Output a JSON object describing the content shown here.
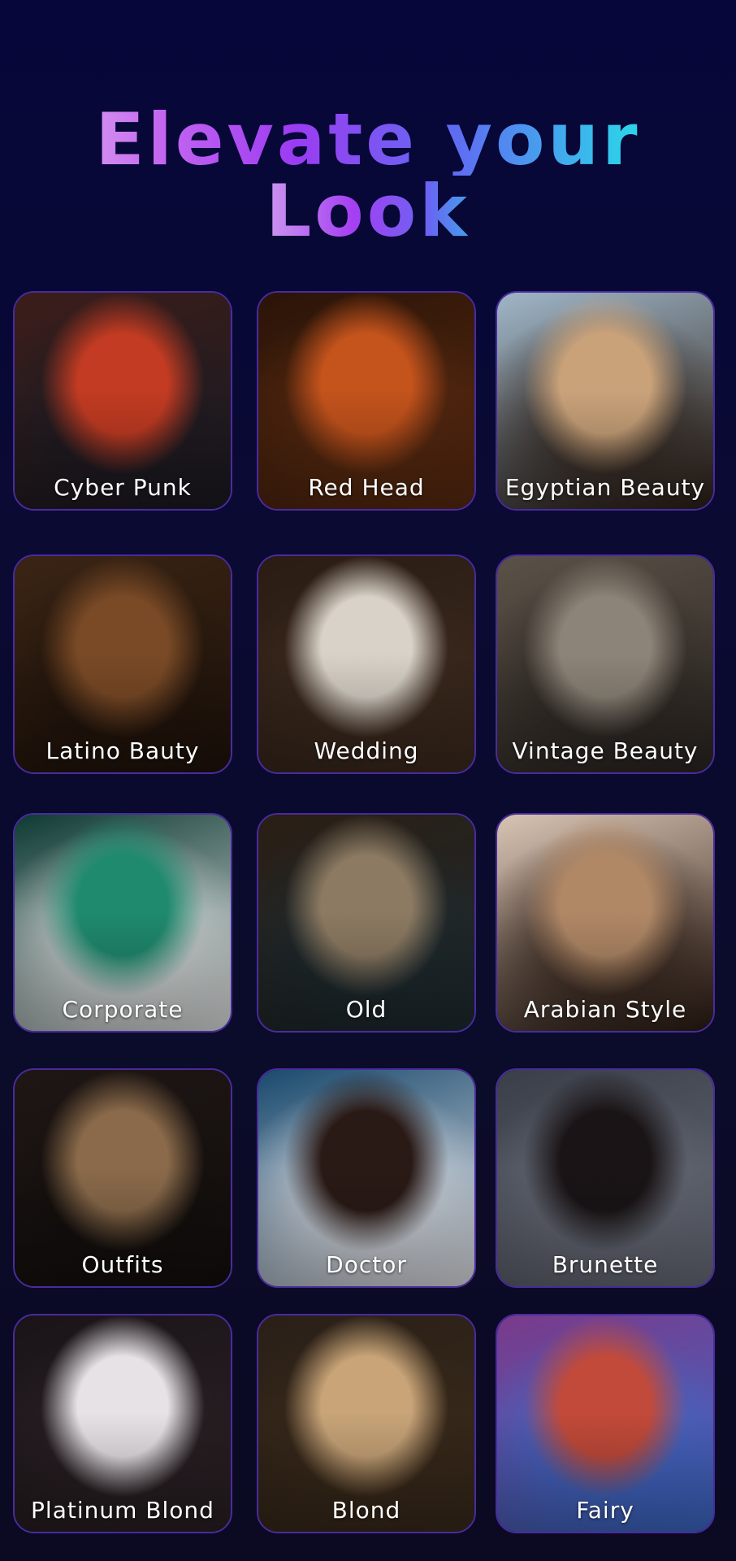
{
  "header": {
    "title_line1": "Elevate your",
    "title_line2": "Look"
  },
  "colors": {
    "background": "#07073a",
    "card_border": "#4a2b9e",
    "label_text": "#ffffff",
    "gradient_start": "#e7c8ef",
    "gradient_mid": "#9b3cf2",
    "gradient_end": "#2fd0ea"
  },
  "styles": [
    {
      "label": "Cyber Punk",
      "icon": "cyberpunk-portrait",
      "tone_a": "#3b1d1a",
      "tone_b": "#c23b22",
      "tone_c": "#1a1a22"
    },
    {
      "label": "Red Head",
      "icon": "redhead-portrait",
      "tone_a": "#2a1408",
      "tone_b": "#c4531c",
      "tone_c": "#5a2a10"
    },
    {
      "label": "Egyptian Beauty",
      "icon": "egyptian-portrait",
      "tone_a": "#9fb6c8",
      "tone_b": "#c9a27a",
      "tone_c": "#2b1d14"
    },
    {
      "label": "Latino Bauty",
      "icon": "latino-portrait",
      "tone_a": "#3a2414",
      "tone_b": "#7a4a26",
      "tone_c": "#1e120a"
    },
    {
      "label": "Wedding",
      "icon": "wedding-portrait",
      "tone_a": "#2a1c14",
      "tone_b": "#d8d2c8",
      "tone_c": "#3c2a1e"
    },
    {
      "label": "Vintage Beauty",
      "icon": "vintage-portrait",
      "tone_a": "#5a5248",
      "tone_b": "#8c8478",
      "tone_c": "#2a2420"
    },
    {
      "label": "Corporate",
      "icon": "corporate-portrait",
      "tone_a": "#0e3a34",
      "tone_b": "#1f8a6e",
      "tone_c": "#e6e6e6"
    },
    {
      "label": "Old",
      "icon": "old-portrait",
      "tone_a": "#2a1e14",
      "tone_b": "#8c7a62",
      "tone_c": "#1c2a30"
    },
    {
      "label": "Arabian Style",
      "icon": "arabian-portrait",
      "tone_a": "#d8c4b4",
      "tone_b": "#b08866",
      "tone_c": "#2a1a12"
    },
    {
      "label": "Outfits",
      "icon": "outfits-portrait",
      "tone_a": "#1e1614",
      "tone_b": "#8a6a4a",
      "tone_c": "#120e0c"
    },
    {
      "label": "Doctor",
      "icon": "doctor-portrait",
      "tone_a": "#1a4a6e",
      "tone_b": "#2a1a16",
      "tone_c": "#e4e4e8"
    },
    {
      "label": "Brunette",
      "icon": "brunette-portrait",
      "tone_a": "#3a3e48",
      "tone_b": "#1a1416",
      "tone_c": "#6a6e7a"
    },
    {
      "label": "Platinum Blond",
      "icon": "platinum-blond-portrait",
      "tone_a": "#1a1418",
      "tone_b": "#e6e2e6",
      "tone_c": "#2a2024"
    },
    {
      "label": "Blond",
      "icon": "blond-portrait",
      "tone_a": "#2a2018",
      "tone_b": "#c8a478",
      "tone_c": "#3a2a1a"
    },
    {
      "label": "Fairy",
      "icon": "fairy-portrait",
      "tone_a": "#7a3a8a",
      "tone_b": "#c24a3a",
      "tone_c": "#3a6ac8"
    }
  ]
}
